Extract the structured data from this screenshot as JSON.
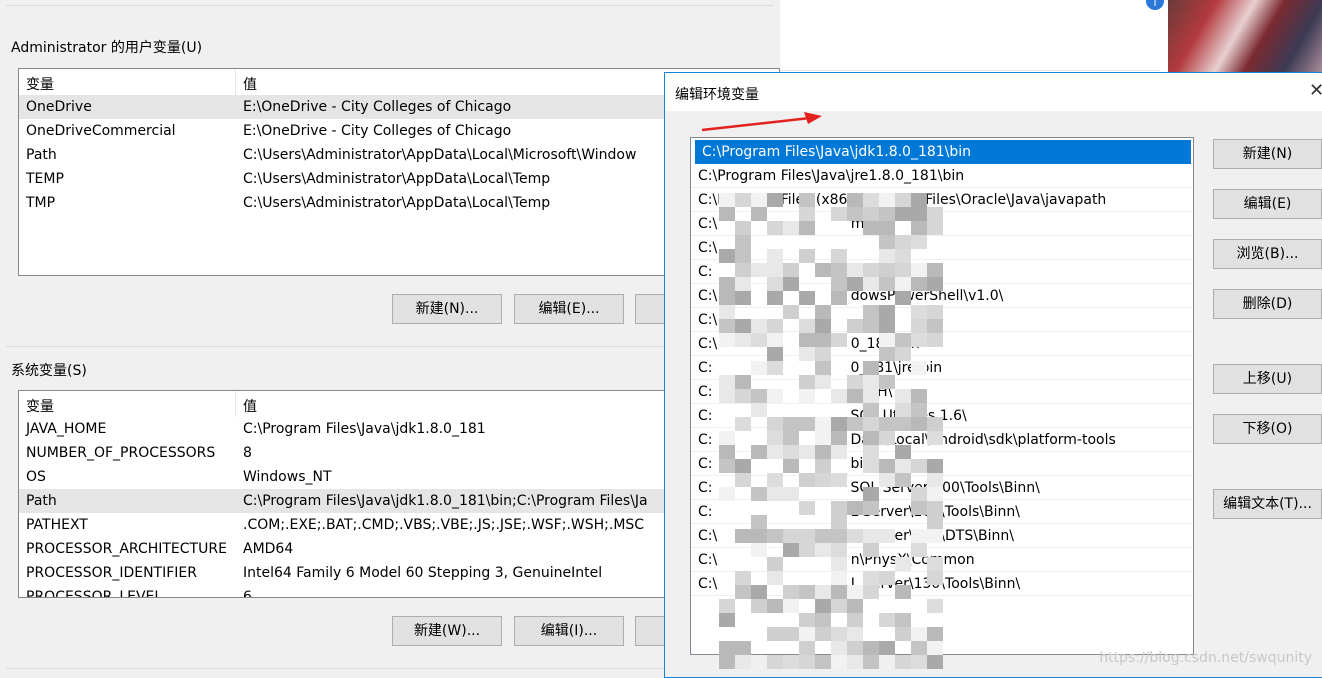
{
  "user_vars": {
    "group_title": "Administrator 的用户变量(U)",
    "col_name": "变量",
    "col_value": "值",
    "rows": [
      {
        "name": "OneDrive",
        "value": "E:\\OneDrive - City Colleges of Chicago"
      },
      {
        "name": "OneDriveCommercial",
        "value": "E:\\OneDrive - City Colleges of Chicago"
      },
      {
        "name": "Path",
        "value": "C:\\Users\\Administrator\\AppData\\Local\\Microsoft\\Window"
      },
      {
        "name": "TEMP",
        "value": "C:\\Users\\Administrator\\AppData\\Local\\Temp"
      },
      {
        "name": "TMP",
        "value": "C:\\Users\\Administrator\\AppData\\Local\\Temp"
      }
    ],
    "new_btn": "新建(N)...",
    "edit_btn": "编辑(E)..."
  },
  "sys_vars": {
    "group_title": "系统变量(S)",
    "col_name": "变量",
    "col_value": "值",
    "rows": [
      {
        "name": "JAVA_HOME",
        "value": "C:\\Program Files\\Java\\jdk1.8.0_181"
      },
      {
        "name": "NUMBER_OF_PROCESSORS",
        "value": "8"
      },
      {
        "name": "OS",
        "value": "Windows_NT"
      },
      {
        "name": "Path",
        "value": "C:\\Program Files\\Java\\jdk1.8.0_181\\bin;C:\\Program Files\\Ja"
      },
      {
        "name": "PATHEXT",
        "value": ".COM;.EXE;.BAT;.CMD;.VBS;.VBE;.JS;.JSE;.WSF;.WSH;.MSC"
      },
      {
        "name": "PROCESSOR_ARCHITECTURE",
        "value": "AMD64"
      },
      {
        "name": "PROCESSOR_IDENTIFIER",
        "value": "Intel64 Family 6 Model 60 Stepping 3, GenuineIntel"
      },
      {
        "name": "PROCESSOR_LEVEL",
        "value": "6"
      }
    ],
    "new_btn": "新建(W)...",
    "edit_btn": "编辑(I)..."
  },
  "edit_dialog": {
    "title": "编辑环境变量",
    "entries": [
      "C:\\Program Files\\Java\\jdk1.8.0_181\\bin",
      "C:\\Program Files\\Java\\jre1.8.0_181\\bin",
      "C:\\Program Files (x86)\\Common Files\\Oracle\\Java\\javapath",
      "C:\\                              m32",
      "C:\\",
      "C:",
      "C:\\                              dowsPowerShell\\v1.0\\",
      "C:\\",
      "C:\\                              0_181\\bin",
      "C:                               0_181\\jre\\bin",
      "C:                               nSSH\\",
      "C:                               SQL Utilities 1.6\\",
      "C:                               Data\\Local\\Android\\sdk\\platform-tools",
      "C:                               bin",
      "C:                               SQL Server\\100\\Tools\\Binn\\",
      "C:                               L Server\\100\\Tools\\Binn\\",
      "C:\\                              L Server\\100\\DTS\\Binn\\",
      "C:\\                              n\\PhysX\\Common",
      "C:\\                              L Server\\130\\Tools\\Binn\\"
    ],
    "buttons": {
      "new": "新建(N)",
      "edit": "编辑(E)",
      "browse": "浏览(B)...",
      "delete": "删除(D)",
      "move_up": "上移(U)",
      "move_down": "下移(O)",
      "edit_text": "编辑文本(T)..."
    }
  },
  "watermark": "https://blog.csdn.net/swqunity",
  "colors": {
    "selection": "#0078d7",
    "arrow": "#e52020",
    "title_border": "#1883d7"
  }
}
